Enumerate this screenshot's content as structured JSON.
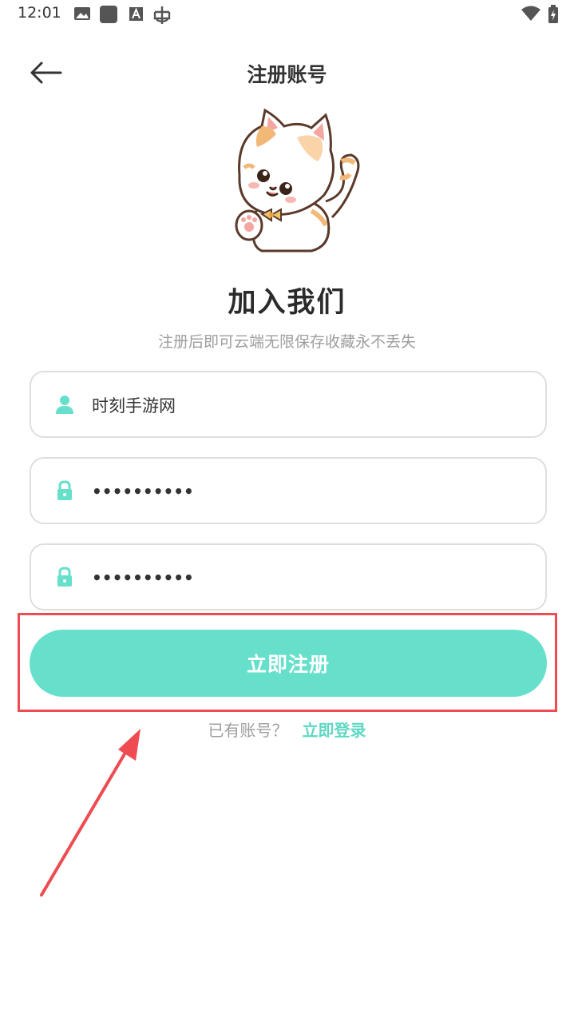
{
  "status_bar": {
    "time": "12:01",
    "left_icons": [
      "image-icon",
      "square-icon",
      "font-icon",
      "bug-icon"
    ],
    "right_icons": [
      "wifi-icon",
      "battery-icon"
    ]
  },
  "header": {
    "back_icon": "arrow-left-icon",
    "title": "注册账号"
  },
  "main": {
    "heading": "加入我们",
    "subtitle": "注册后即可云端无限保存收藏永不丢失"
  },
  "form": {
    "username": {
      "value": "时刻手游网",
      "icon": "user-icon"
    },
    "password": {
      "value": "••••••••••",
      "icon": "lock-icon"
    },
    "confirm_password": {
      "value": "••••••••••",
      "icon": "lock-icon"
    },
    "submit_label": "立即注册"
  },
  "footer": {
    "prompt": "已有账号？",
    "login_link": "立即登录"
  },
  "colors": {
    "accent": "#66e0cb",
    "link": "#5fd8c3",
    "annotation": "#ee4b52"
  }
}
